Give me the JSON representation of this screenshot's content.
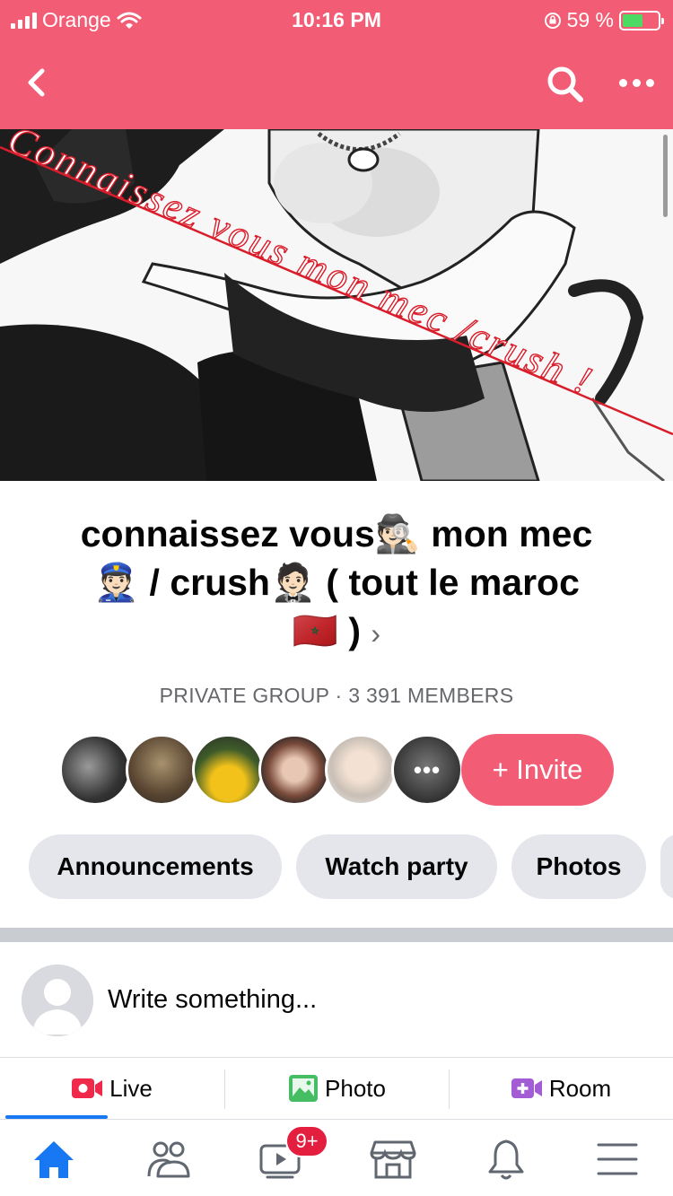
{
  "status_bar": {
    "carrier": "Orange",
    "time": "10:16 PM",
    "battery": "59 %",
    "battery_level": 0.59
  },
  "header": {
    "back_icon": "chevron-left-icon",
    "search_icon": "search-icon",
    "more_icon": "more-icon"
  },
  "cover": {
    "watermark": "Connaissez vous mon mec /crush !"
  },
  "group": {
    "title_line1": "connaissez vous🕵🏻 mon mec",
    "title_line2": "👮🏻 / crush🤵🏻 ( tout le maroc",
    "title_line3": "🇲🇦 )",
    "chevron": "›",
    "meta": "PRIVATE GROUP · 3 391 MEMBERS"
  },
  "members": {
    "more_label": "•••"
  },
  "invite_label": "+ Invite",
  "chips": [
    "Announcements",
    "Watch party",
    "Photos"
  ],
  "composer": {
    "placeholder": "Write something..."
  },
  "actions": {
    "live": "Live",
    "photo": "Photo",
    "room": "Room"
  },
  "tabbar": {
    "badge": "9+"
  },
  "colors": {
    "brand": "#f25d75",
    "fb_blue": "#1877f2",
    "chip_bg": "#e4e6eb",
    "live_red": "#f02849",
    "photo_green": "#45bd62",
    "room_purple": "#a35cd6"
  }
}
